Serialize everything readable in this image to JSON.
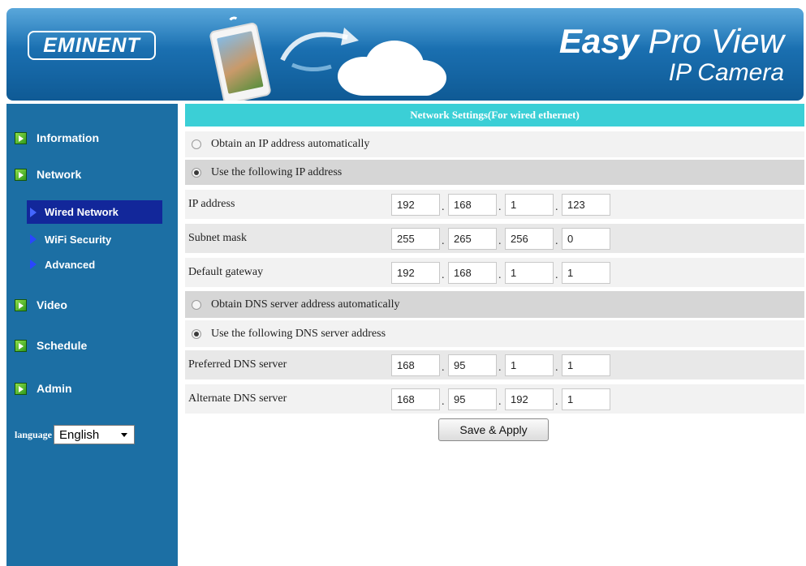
{
  "header": {
    "logo_text": "EMINENT",
    "brand_easy": "Easy",
    "brand_rest": " Pro View",
    "brand_subtitle": "IP Camera"
  },
  "sidebar": {
    "items": [
      {
        "label": "Information",
        "icon": "green-arrow-icon"
      },
      {
        "label": "Network",
        "icon": "green-arrow-icon"
      },
      {
        "label": "Video",
        "icon": "green-arrow-icon"
      },
      {
        "label": "Schedule",
        "icon": "green-arrow-icon"
      },
      {
        "label": "Admin",
        "icon": "green-arrow-icon"
      }
    ],
    "network_subitems": [
      {
        "label": "Wired Network",
        "active": true
      },
      {
        "label": "WiFi Security",
        "active": false
      },
      {
        "label": "Advanced",
        "active": false
      }
    ],
    "language_label": "language",
    "language_value": "English"
  },
  "main": {
    "title": "Network Settings(For wired ethernet)",
    "ip_mode": {
      "option_auto": "Obtain an IP address automatically",
      "option_manual": "Use the following IP address",
      "selected": "manual"
    },
    "ip_address": {
      "label": "IP address",
      "octets": [
        "192",
        "168",
        "1",
        "123"
      ]
    },
    "subnet_mask": {
      "label": "Subnet mask",
      "octets": [
        "255",
        "265",
        "256",
        "0"
      ]
    },
    "default_gateway": {
      "label": "Default gateway",
      "octets": [
        "192",
        "168",
        "1",
        "1"
      ]
    },
    "dns_mode": {
      "option_auto": "Obtain DNS server address automatically",
      "option_manual": "Use the following DNS server address",
      "selected": "manual"
    },
    "preferred_dns": {
      "label": "Preferred DNS server",
      "octets": [
        "168",
        "95",
        "1",
        "1"
      ]
    },
    "alternate_dns": {
      "label": "Alternate DNS server",
      "octets": [
        "168",
        "95",
        "192",
        "1"
      ]
    },
    "separator": ".",
    "save_label": "Save & Apply"
  },
  "colors": {
    "sidebar_bg": "#1c6fa4",
    "title_bar_bg": "#3bcfd6",
    "active_subitem_bg": "#12279a",
    "bullet_green": "#3aa820"
  }
}
